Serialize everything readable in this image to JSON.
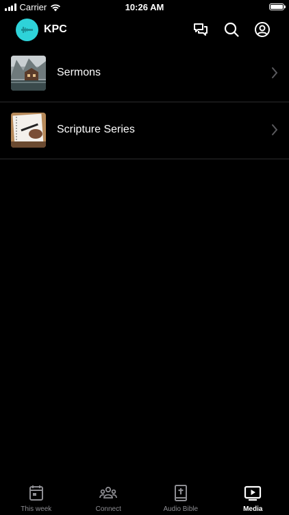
{
  "status_bar": {
    "carrier": "Carrier",
    "time": "10:26 AM"
  },
  "header": {
    "title": "KPC",
    "icons": [
      "messages-icon",
      "search-icon",
      "account-icon"
    ]
  },
  "items": [
    {
      "label": "Sermons",
      "thumbnail": "lake-house-thumbnail"
    },
    {
      "label": "Scripture Series",
      "thumbnail": "notebook-writing-thumbnail"
    }
  ],
  "tabs": [
    {
      "label": "This week",
      "icon": "calendar-icon",
      "active": false
    },
    {
      "label": "Connect",
      "icon": "group-icon",
      "active": false
    },
    {
      "label": "Audio Bible",
      "icon": "bible-icon",
      "active": false
    },
    {
      "label": "Media",
      "icon": "play-video-icon",
      "active": true
    }
  ],
  "colors": {
    "background": "#000000",
    "logo": "#2ed3d9",
    "divider": "#2c2c2e",
    "inactive_tab": "#8e8e93",
    "active_tab": "#ffffff"
  }
}
